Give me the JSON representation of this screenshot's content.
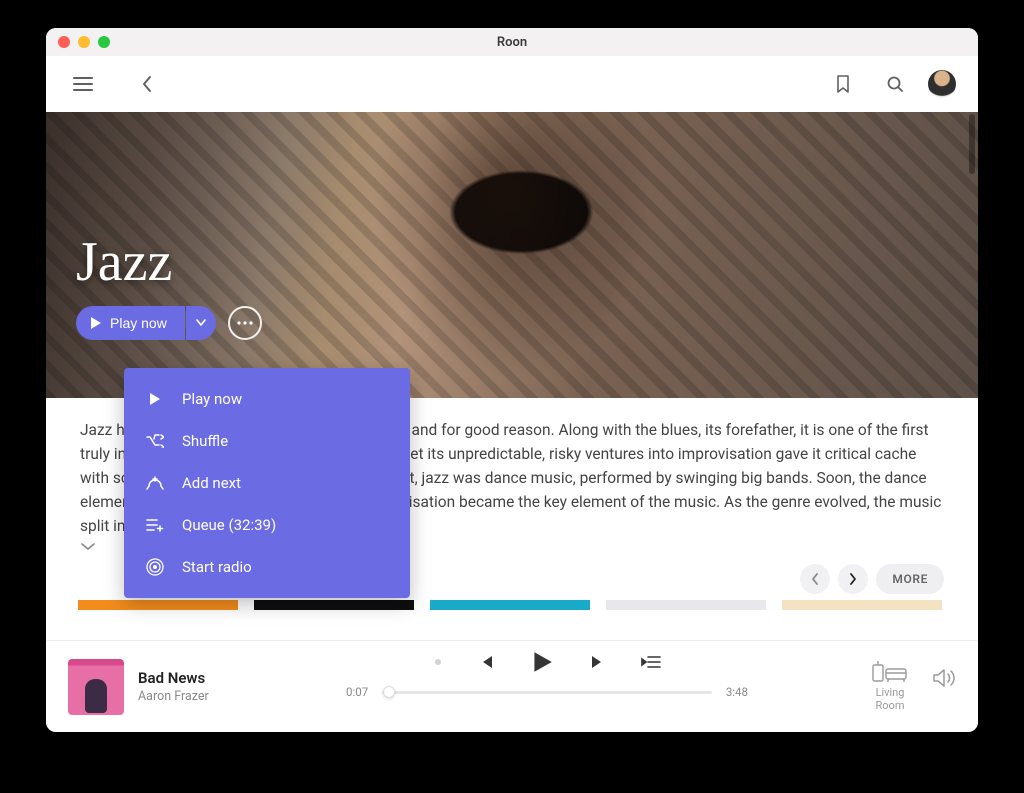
{
  "window": {
    "title": "Roon"
  },
  "hero": {
    "title": "Jazz",
    "play_label": "Play now"
  },
  "dropdown": {
    "items": [
      {
        "icon": "play",
        "label": "Play now"
      },
      {
        "icon": "shuffle",
        "label": "Shuffle"
      },
      {
        "icon": "add-next",
        "label": "Add next"
      },
      {
        "icon": "queue",
        "label": "Queue (32:39)"
      },
      {
        "icon": "radio",
        "label": "Start radio"
      }
    ]
  },
  "description": "Jazz has been called America's classical music, and for good reason. Along with the blues, its forefather, it is one of the first truly indigenous musics to develop in America, yet its unpredictable, risky ventures into improvisation gave it critical cache with scholars that the blues lacked. At the outset, jazz was dance music, performed by swinging big bands. Soon, the dance elements faded into the background and improvisation became the key element of the music. As the genre evolved, the music split into a",
  "section": {
    "more_label": "MORE"
  },
  "player": {
    "track_title": "Bad News",
    "track_artist": "Aaron Frazer",
    "elapsed": "0:07",
    "duration": "3:48",
    "zone_line1": "Living",
    "zone_line2": "Room"
  }
}
